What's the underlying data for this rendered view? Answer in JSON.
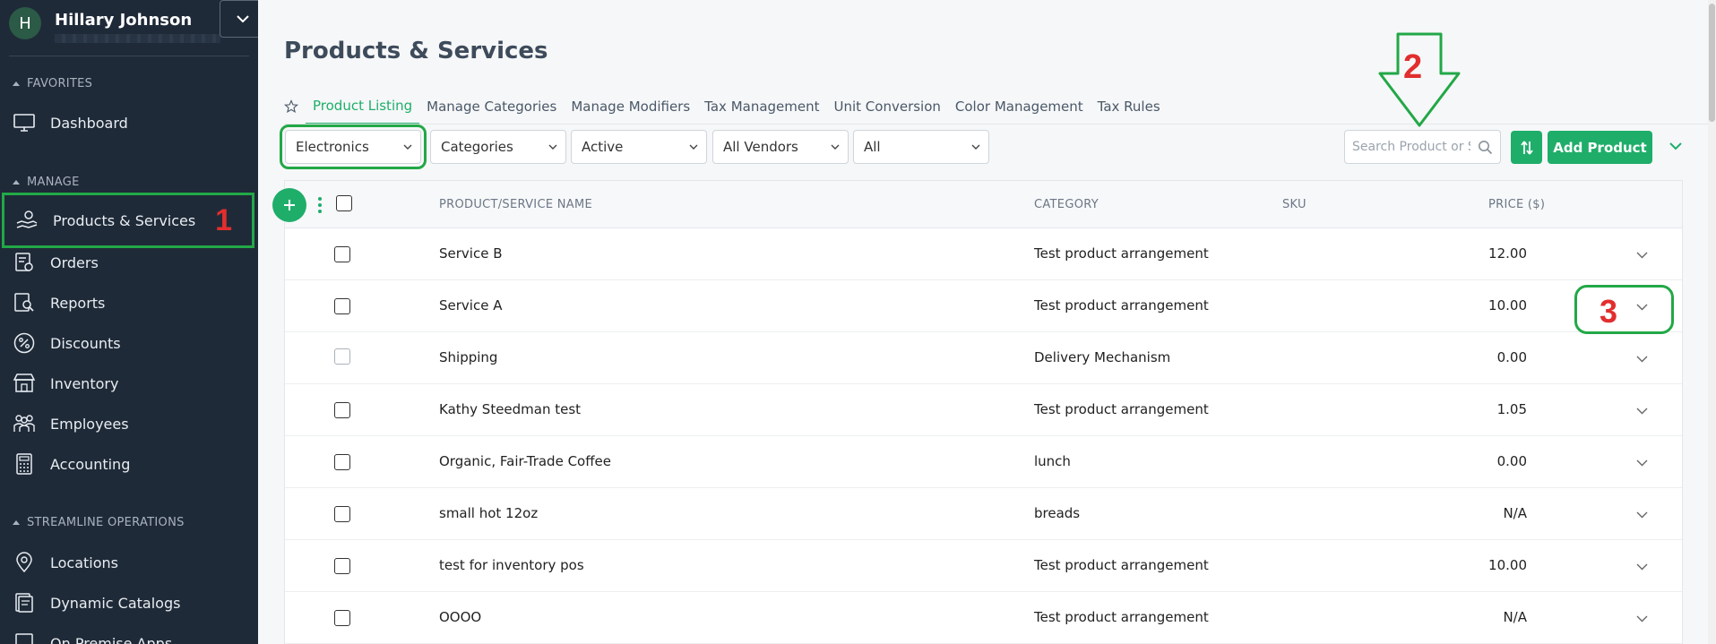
{
  "user": {
    "initial": "H",
    "name": "Hillary Johnson"
  },
  "sidebar": {
    "favorites_label": "FAVORITES",
    "manage_label": "MANAGE",
    "streamline_label": "STREAMLINE OPERATIONS",
    "items": [
      {
        "label": "Dashboard",
        "icon": "monitor-icon"
      },
      {
        "label": "Products & Services",
        "icon": "hand-coins-icon",
        "badge": "1"
      },
      {
        "label": "Orders",
        "icon": "orders-icon"
      },
      {
        "label": "Reports",
        "icon": "reports-icon"
      },
      {
        "label": "Discounts",
        "icon": "percent-icon"
      },
      {
        "label": "Inventory",
        "icon": "store-icon"
      },
      {
        "label": "Employees",
        "icon": "people-icon"
      },
      {
        "label": "Accounting",
        "icon": "calculator-icon"
      },
      {
        "label": "Locations",
        "icon": "location-pin-icon"
      },
      {
        "label": "Dynamic Catalogs",
        "icon": "catalog-icon"
      },
      {
        "label": "On Premise Apps",
        "icon": "apps-icon"
      }
    ]
  },
  "page": {
    "title": "Products & Services"
  },
  "tabs": [
    "Product Listing",
    "Manage Categories",
    "Manage Modifiers",
    "Tax Management",
    "Unit Conversion",
    "Color Management",
    "Tax Rules"
  ],
  "filters": {
    "department": "Electronics",
    "categories": "Categories",
    "status": "Active",
    "vendors": "All Vendors",
    "other": "All"
  },
  "search": {
    "placeholder": "Search Product or SKU"
  },
  "toolbar": {
    "add_label": "Add Product"
  },
  "annotations": {
    "two": "2",
    "three": "3"
  },
  "table": {
    "headers": {
      "name": "PRODUCT/SERVICE NAME",
      "category": "CATEGORY",
      "sku": "SKU",
      "price": "PRICE ($)"
    },
    "rows": [
      {
        "name": "Service B",
        "category": "Test product arrangement",
        "sku": "",
        "price": "12.00"
      },
      {
        "name": "Service A",
        "category": "Test product arrangement",
        "sku": "",
        "price": "10.00"
      },
      {
        "name": "Shipping",
        "category": "Delivery Mechanism",
        "sku": "",
        "price": "0.00"
      },
      {
        "name": "Kathy Steedman test",
        "category": "Test product arrangement",
        "sku": "",
        "price": "1.05"
      },
      {
        "name": "Organic, Fair-Trade Coffee",
        "category": "lunch",
        "sku": "",
        "price": "0.00"
      },
      {
        "name": "small hot 12oz",
        "category": "breads",
        "sku": "",
        "price": "N/A"
      },
      {
        "name": "test for inventory pos",
        "category": "Test product arrangement",
        "sku": "",
        "price": "10.00"
      },
      {
        "name": "OOOO",
        "category": "Test product arrangement",
        "sku": "",
        "price": "N/A"
      }
    ]
  },
  "colors": {
    "accent": "#1fae6a",
    "sidebar_bg": "#1f2a38",
    "annotation_green": "#22a847",
    "annotation_red": "#e22e2e"
  }
}
